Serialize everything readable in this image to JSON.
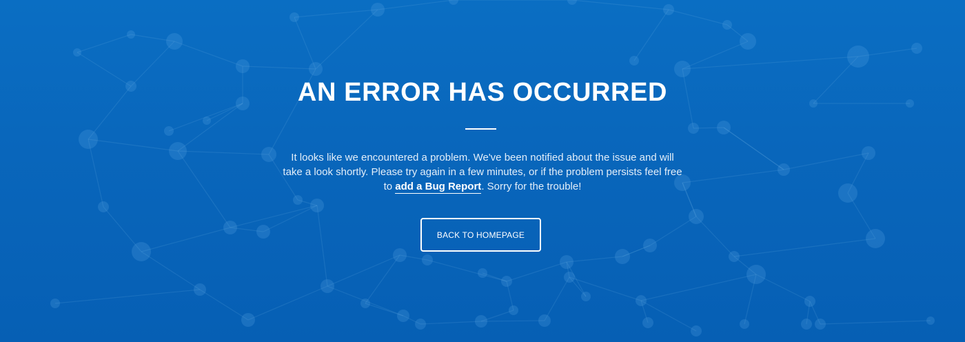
{
  "page": {
    "background_color": "#0966bb",
    "accent_color": "#ffffff",
    "background_decoration": "network-graph-pattern"
  },
  "error": {
    "title": "AN ERROR HAS OCCURRED",
    "message_before_link": "It looks like we encountered a problem. We've been notified about the issue and will take a look shortly. Please try again in a few minutes, or if the problem persists feel free to ",
    "link_label": "add a Bug Report",
    "message_after_link": ". Sorry for the trouble!"
  },
  "actions": {
    "home_button_label": "BACK TO HOMEPAGE"
  }
}
